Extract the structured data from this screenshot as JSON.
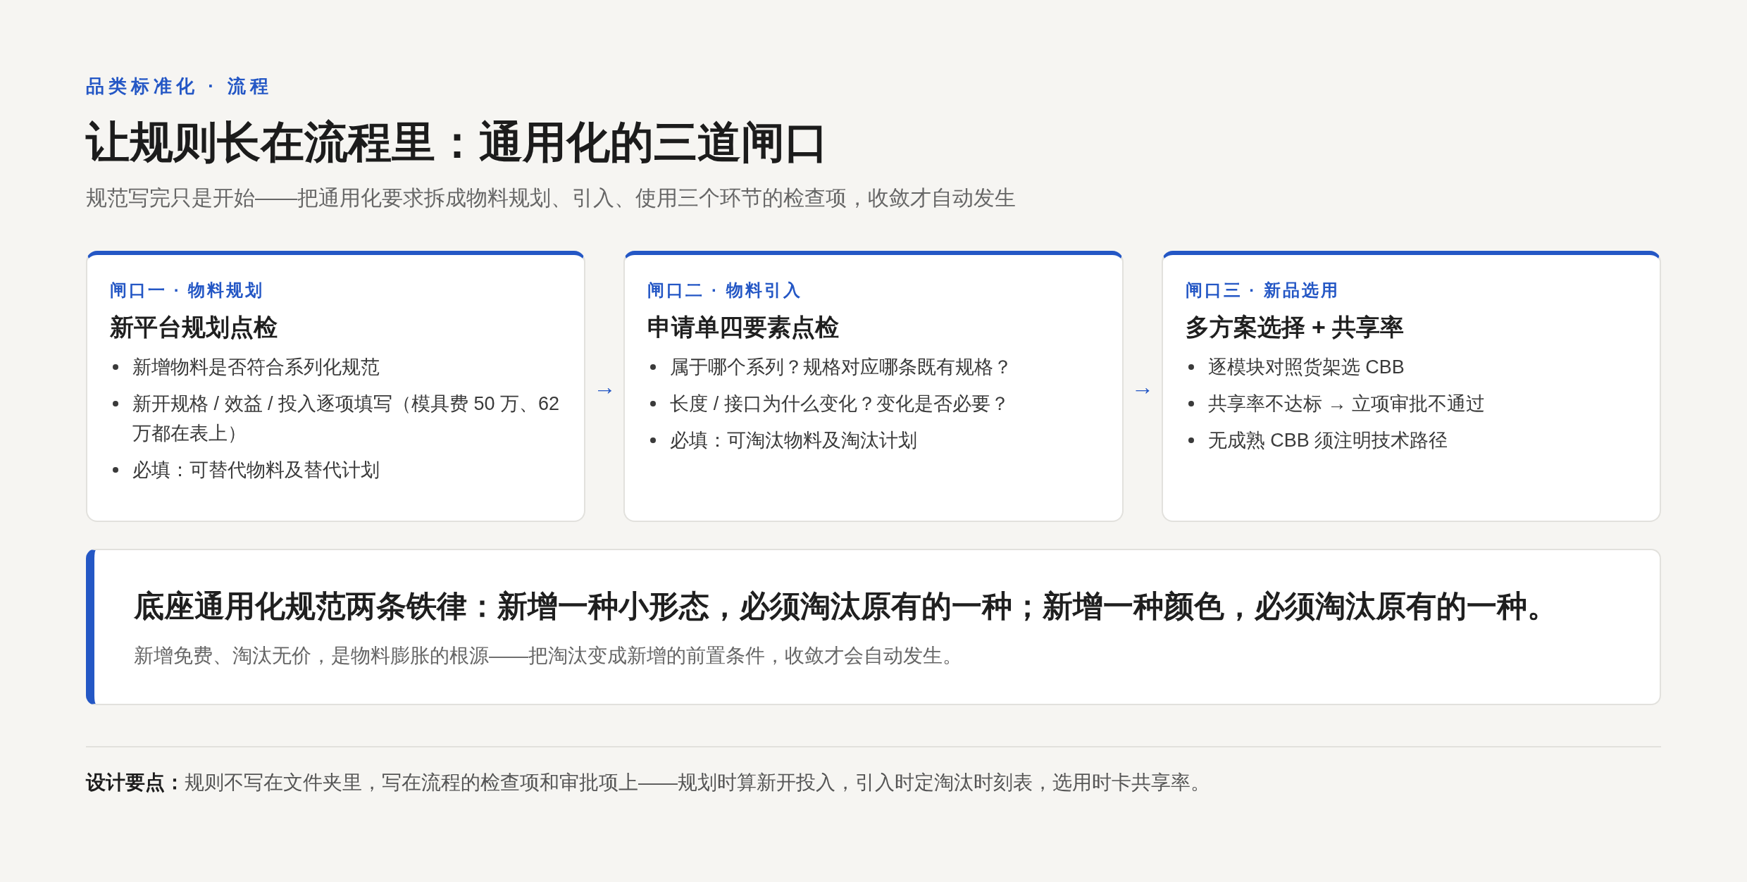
{
  "eyebrow": "品类标准化 · 流程",
  "title": "让规则长在流程里：通用化的三道闸口",
  "subtitle": "规范写完只是开始——把通用化要求拆成物料规划、引入、使用三个环节的检查项，收敛才自动发生",
  "gates": [
    {
      "label": "闸口一 · 物料规划",
      "heading": "新平台规划点检",
      "items": [
        "新增物料是否符合系列化规范",
        "新开规格 / 效益 / 投入逐项填写（模具费 50 万、62 万都在表上）",
        "必填：可替代物料及替代计划"
      ]
    },
    {
      "label": "闸口二 · 物料引入",
      "heading": "申请单四要素点检",
      "items": [
        "属于哪个系列？规格对应哪条既有规格？",
        "长度 / 接口为什么变化？变化是否必要？",
        "必填：可淘汰物料及淘汰计划"
      ]
    },
    {
      "label": "闸口三 · 新品选用",
      "heading": "多方案选择 + 共享率",
      "items": [
        "逐模块对照货架选 CBB",
        "共享率不达标 → 立项审批不通过",
        "无成熟 CBB 须注明技术路径"
      ]
    }
  ],
  "connectors": [
    "→",
    "→"
  ],
  "callout": {
    "heading": "底座通用化规范两条铁律：新增一种小形态，必须淘汰原有的一种；新增一种颜色，必须淘汰原有的一种。",
    "body": "新增免费、淘汰无价，是物料膨胀的根源——把淘汰变成新增的前置条件，收敛才会自动发生。"
  },
  "footer": "**设计要点：**规则不写在文件夹里，写在流程的检查项和审批项上——规划时算新开投入，引入时定淘汰时刻表，选用时卡共享率。"
}
